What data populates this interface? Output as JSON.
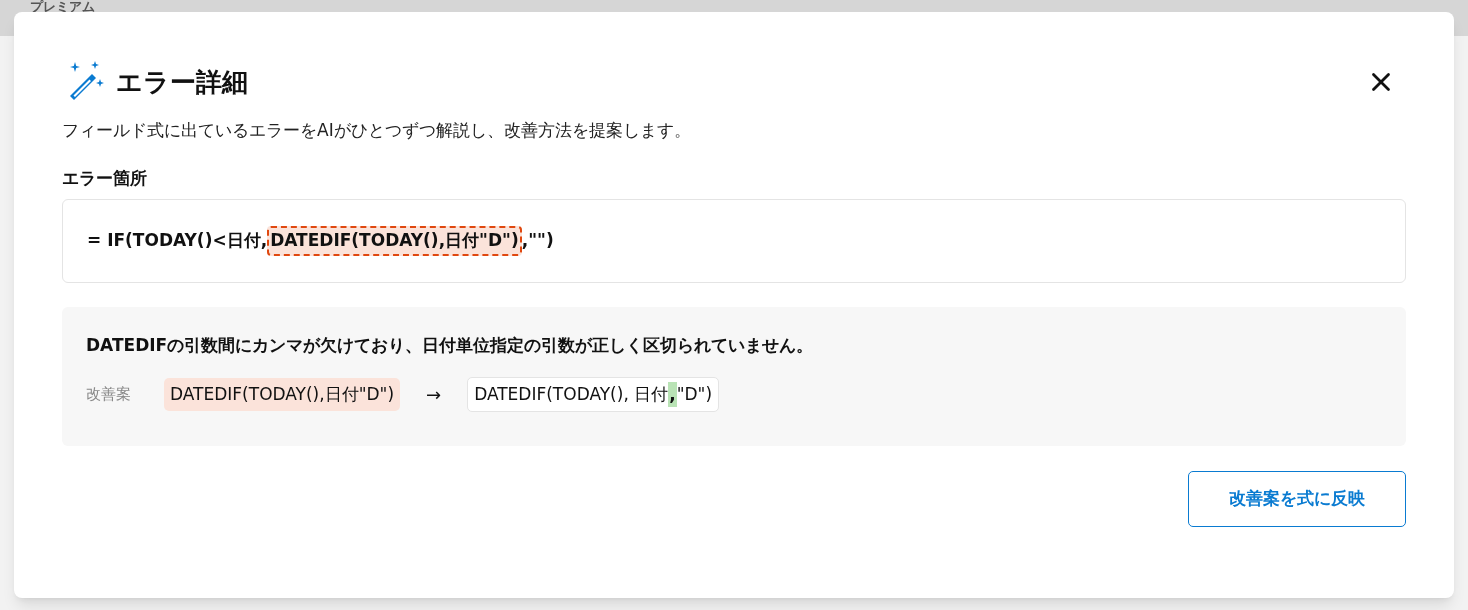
{
  "background": {
    "header_text": "プレミアム"
  },
  "dialog": {
    "title": "エラー詳細",
    "description": "フィールド式に出ているエラーをAIがひとつずつ解説し、改善方法を提案します。",
    "location_label": "エラー箇所",
    "formula": [
      {
        "text": "= IF(TODAY()<日付,",
        "kind": "plain"
      },
      {
        "text": "DATEDIF(TODAY(),日付\"D\")",
        "kind": "error"
      },
      {
        "text": ",\"\")",
        "kind": "plain"
      }
    ],
    "explanation": "DATEDIFの引数間にカンマが欠けており、日付単位指定の引数が正しく区切られていません。",
    "suggestion_label": "改善案",
    "before": "DATEDIF(TODAY(),日付\"D\")",
    "arrow": "→",
    "after": [
      {
        "text": "DATEDIF(TODAY(), 日付",
        "kind": "plain"
      },
      {
        "text": ",",
        "kind": "inserted"
      },
      {
        "text": "\"D\")",
        "kind": "plain"
      }
    ],
    "apply_button": "改善案を式に反映"
  }
}
